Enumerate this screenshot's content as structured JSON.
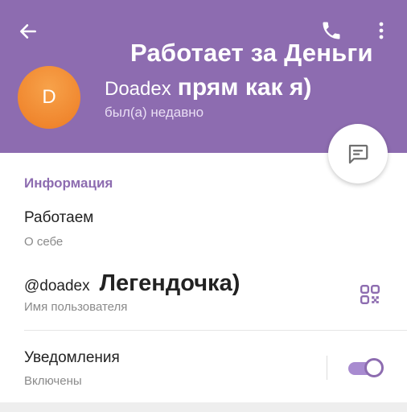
{
  "header": {
    "overlay_title": "Работает за Деньги",
    "avatar_letter": "D",
    "name": "Doadex",
    "name_overlay": "прям как я)",
    "status": "был(а) недавно"
  },
  "info": {
    "section_title": "Информация",
    "bio": {
      "value": "Работаем",
      "label": "О себе"
    },
    "username": {
      "value": "@doadex",
      "overlay": "Легендочка)",
      "label": "Имя пользователя"
    }
  },
  "notifications": {
    "title": "Уведомления",
    "status": "Включены",
    "enabled": true
  },
  "icons": {
    "back": "arrow-left-icon",
    "call": "phone-icon",
    "more": "more-vertical-icon",
    "message": "message-icon",
    "qr": "qr-code-icon"
  },
  "colors": {
    "header": "#8d6cb0",
    "accent": "#8d6cb0",
    "avatar": "#f0872f"
  }
}
